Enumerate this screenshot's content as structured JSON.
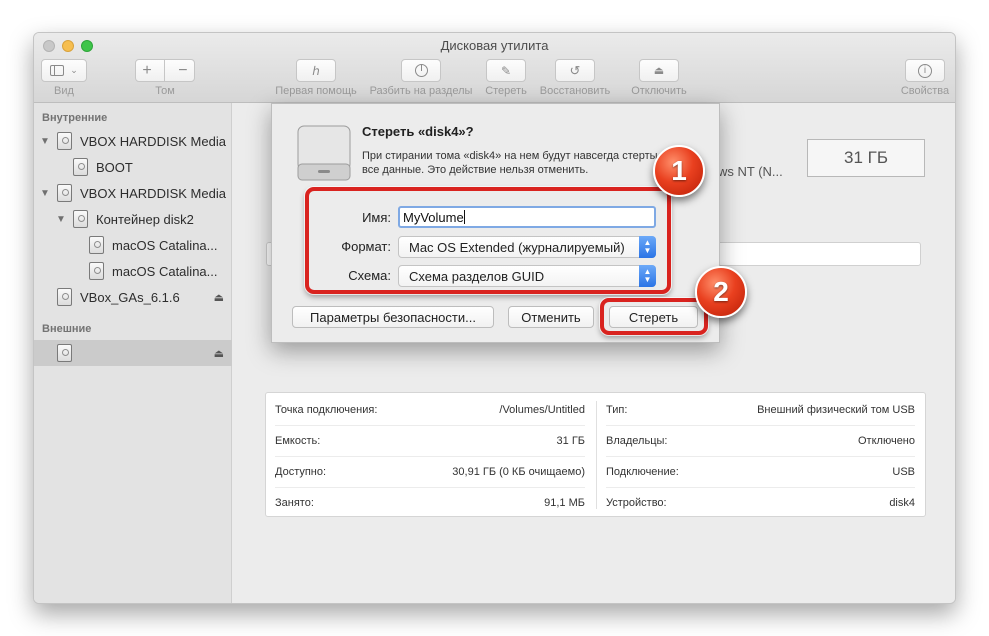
{
  "window": {
    "title": "Дисковая утилита"
  },
  "toolbar": {
    "view_label": "Вид",
    "volume_label": "Том",
    "first_aid_label": "Первая помощь",
    "partition_label": "Разбить на разделы",
    "erase_label": "Стереть",
    "restore_label": "Восстановить",
    "unmount_label": "Отключить",
    "info_label": "Свойства",
    "plus": "+",
    "minus": "−"
  },
  "sidebar": {
    "internal_header": "Внутренние",
    "external_header": "Внешние",
    "items": [
      {
        "label": "VBOX HARDDISK Media"
      },
      {
        "label": "BOOT"
      },
      {
        "label": "VBOX HARDDISK Media"
      },
      {
        "label": "Контейнер disk2"
      },
      {
        "label": "macOS Catalina..."
      },
      {
        "label": "macOS Catalina..."
      },
      {
        "label": "VBox_GAs_6.1.6"
      }
    ]
  },
  "main": {
    "capacity_box": "31 ГБ",
    "partial_text": "ws NT (N...",
    "info_left": [
      {
        "key": "Точка подключения:",
        "value": "/Volumes/Untitled"
      },
      {
        "key": "Емкость:",
        "value": "31 ГБ"
      },
      {
        "key": "Доступно:",
        "value": "30,91 ГБ (0 КБ очищаемо)"
      },
      {
        "key": "Занято:",
        "value": "91,1 МБ"
      }
    ],
    "info_right": [
      {
        "key": "Тип:",
        "value": "Внешний физический том USB"
      },
      {
        "key": "Владельцы:",
        "value": "Отключено"
      },
      {
        "key": "Подключение:",
        "value": "USB"
      },
      {
        "key": "Устройство:",
        "value": "disk4"
      }
    ]
  },
  "sheet": {
    "title": "Стереть «disk4»?",
    "message": "При стирании тома «disk4» на нем будут навсегда стерты все данные. Это действие нельзя отменить.",
    "name_label": "Имя:",
    "name_value": "MyVolume",
    "format_label": "Формат:",
    "format_value": "Mac OS Extended (журналируемый)",
    "scheme_label": "Схема:",
    "scheme_value": "Схема разделов GUID",
    "security_button": "Параметры безопасности...",
    "cancel_button": "Отменить",
    "erase_button": "Стереть"
  },
  "annotations": {
    "badge_1": "1",
    "badge_2": "2",
    "accent_color": "#d9231f"
  }
}
